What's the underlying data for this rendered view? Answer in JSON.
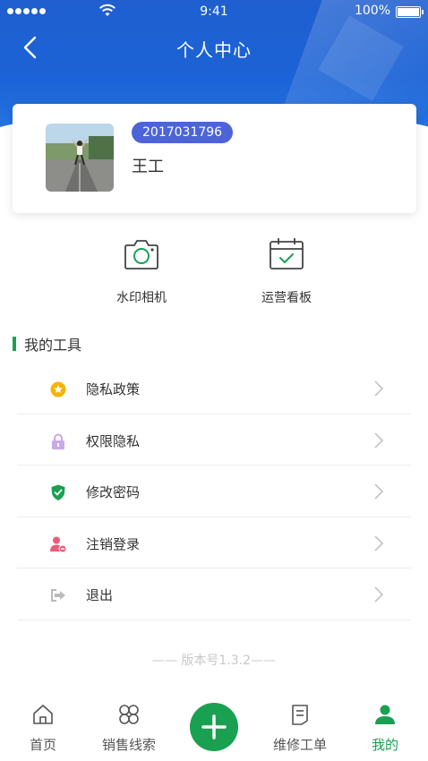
{
  "status_bar": {
    "time": "9:41",
    "battery": "100%"
  },
  "nav": {
    "title": "个人中心",
    "back_icon": "chevron-left-icon"
  },
  "profile": {
    "id": "2017031796",
    "name": "王工",
    "avatar": "runner-photo"
  },
  "quick_actions": [
    {
      "label": "水印相机",
      "icon": "camera-icon"
    },
    {
      "label": "运营看板",
      "icon": "calendar-check-icon"
    }
  ],
  "tools": {
    "title": "我的工具",
    "items": [
      {
        "label": "隐私政策",
        "icon": "star-circle-icon",
        "color": "#f5b400"
      },
      {
        "label": "权限隐私",
        "icon": "lock-icon",
        "color": "#c9a8e8"
      },
      {
        "label": "修改密码",
        "icon": "shield-check-icon",
        "color": "#1aa051"
      },
      {
        "label": "注销登录",
        "icon": "user-remove-icon",
        "color": "#ec5b78"
      },
      {
        "label": "退出",
        "icon": "logout-icon",
        "color": "#bbbbbb"
      }
    ]
  },
  "version": "—— 版本号1.3.2——",
  "tabbar": {
    "items": [
      {
        "label": "首页",
        "icon": "home-icon"
      },
      {
        "label": "销售线索",
        "icon": "grid-clover-icon"
      },
      {
        "label": "",
        "icon": "plus-icon"
      },
      {
        "label": "维修工单",
        "icon": "document-icon"
      },
      {
        "label": "我的",
        "icon": "user-icon"
      }
    ],
    "active_color": "#1aa051"
  },
  "colors": {
    "header": "#1f5fd0",
    "badge": "#4c64d8",
    "accent": "#1aa051"
  }
}
